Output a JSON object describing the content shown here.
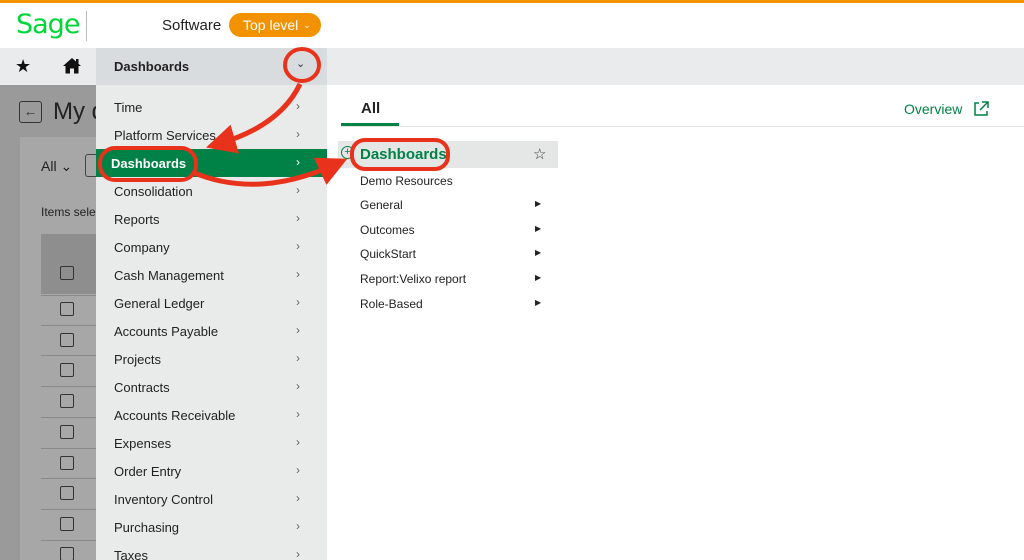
{
  "header": {
    "logo_text": "Sage",
    "company": "Software",
    "level_pill": "Top level",
    "accent_color": "#f39200",
    "brand_color": "#00d639"
  },
  "navbar": {
    "favorites_icon": "star-icon",
    "home_icon": "home-icon",
    "dashboards_label": "Dashboards",
    "dropdown_icon": "chevron-down-icon"
  },
  "background_page": {
    "title": "My d",
    "filter_label": "All",
    "items_selected": "Items sele"
  },
  "menu": {
    "active_color": "#008146",
    "items": [
      {
        "label": "Time"
      },
      {
        "label": "Platform Services"
      },
      {
        "label": "Dashboards",
        "active": true
      },
      {
        "label": "Consolidation"
      },
      {
        "label": "Reports"
      },
      {
        "label": "Company"
      },
      {
        "label": "Cash Management"
      },
      {
        "label": "General Ledger"
      },
      {
        "label": "Accounts Payable"
      },
      {
        "label": "Projects"
      },
      {
        "label": "Contracts"
      },
      {
        "label": "Accounts Receivable"
      },
      {
        "label": "Expenses"
      },
      {
        "label": "Order Entry"
      },
      {
        "label": "Inventory Control"
      },
      {
        "label": "Purchasing"
      },
      {
        "label": "Taxes"
      }
    ]
  },
  "submenu": {
    "tab_label": "All",
    "overview_label": "Overview",
    "overview_icon": "external-link-icon",
    "heading": "Dashboards",
    "heading_icon": "plus-circle-icon",
    "favorite_icon": "star-outline-icon",
    "items": [
      {
        "label": "Demo Resources",
        "has_children": false
      },
      {
        "label": "General",
        "has_children": true
      },
      {
        "label": "Outcomes",
        "has_children": true
      },
      {
        "label": "QuickStart",
        "has_children": true
      },
      {
        "label": "Report:Velixo report",
        "has_children": true
      },
      {
        "label": "Role-Based",
        "has_children": true
      }
    ]
  },
  "annotations": {
    "color": "#e8321c"
  }
}
